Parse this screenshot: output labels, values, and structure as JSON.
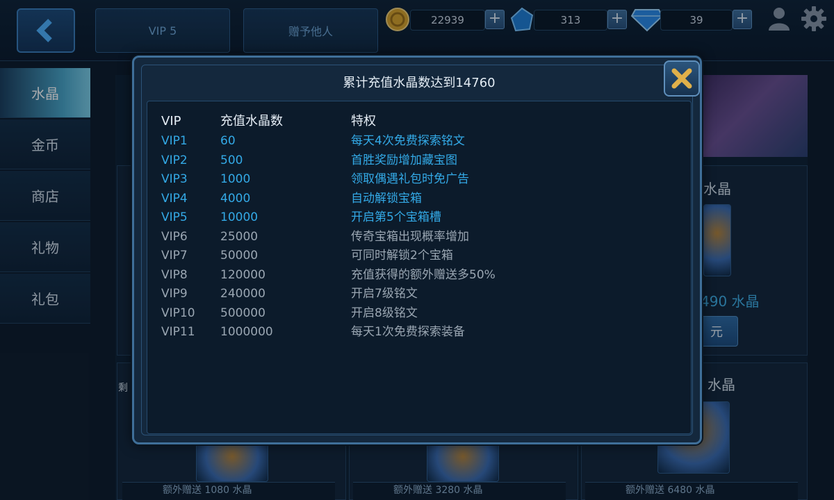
{
  "topbar": {
    "back_icon": "chevron-left-icon",
    "tab_vip": "VIP 5",
    "tab_gift_other": "赠予他人",
    "gold": "22939",
    "crystal": "313",
    "diamond": "39",
    "plus_label": "+"
  },
  "sidebar": {
    "items": [
      {
        "label": "水晶",
        "active": true
      },
      {
        "label": "金币",
        "active": false
      },
      {
        "label": "商店",
        "active": false
      },
      {
        "label": "礼物",
        "active": false
      },
      {
        "label": "礼包",
        "active": false
      }
    ]
  },
  "background": {
    "card_title_1": "水晶",
    "card_price_1": "490 水晶",
    "card_button_1": "元",
    "card_title_2": "水晶",
    "side_tag": "剩",
    "bottom_1": "额外赠送 1080 水晶",
    "bottom_2": "额外赠送 3280 水晶",
    "bottom_3": "额外赠送 6480 水晶"
  },
  "modal": {
    "title": "累计充值水晶数达到14760",
    "close_icon": "close-x-icon",
    "headers": {
      "vip": "VIP",
      "amount": "充值水晶数",
      "privilege": "特权"
    },
    "rows": [
      {
        "vip": "VIP1",
        "amount": "60",
        "privilege": "每天4次免费探索铭文",
        "unlocked": true
      },
      {
        "vip": "VIP2",
        "amount": "500",
        "privilege": "首胜奖励增加藏宝图",
        "unlocked": true
      },
      {
        "vip": "VIP3",
        "amount": "1000",
        "privilege": "领取偶遇礼包时免广告",
        "unlocked": true
      },
      {
        "vip": "VIP4",
        "amount": "4000",
        "privilege": "自动解锁宝箱",
        "unlocked": true
      },
      {
        "vip": "VIP5",
        "amount": "10000",
        "privilege": "开启第5个宝箱槽",
        "unlocked": true
      },
      {
        "vip": "VIP6",
        "amount": "25000",
        "privilege": "传奇宝箱出现概率增加",
        "unlocked": false
      },
      {
        "vip": "VIP7",
        "amount": "50000",
        "privilege": "可同时解锁2个宝箱",
        "unlocked": false
      },
      {
        "vip": "VIP8",
        "amount": "120000",
        "privilege": "充值获得的额外赠送多50%",
        "unlocked": false
      },
      {
        "vip": "VIP9",
        "amount": "240000",
        "privilege": "开启7级铭文",
        "unlocked": false
      },
      {
        "vip": "VIP10",
        "amount": "500000",
        "privilege": "开启8级铭文",
        "unlocked": false
      },
      {
        "vip": "VIP11",
        "amount": "1000000",
        "privilege": "每天1次免费探索装备",
        "unlocked": false
      }
    ]
  },
  "colors": {
    "unlocked": "#33a9e6",
    "locked": "#9aa6b2"
  }
}
